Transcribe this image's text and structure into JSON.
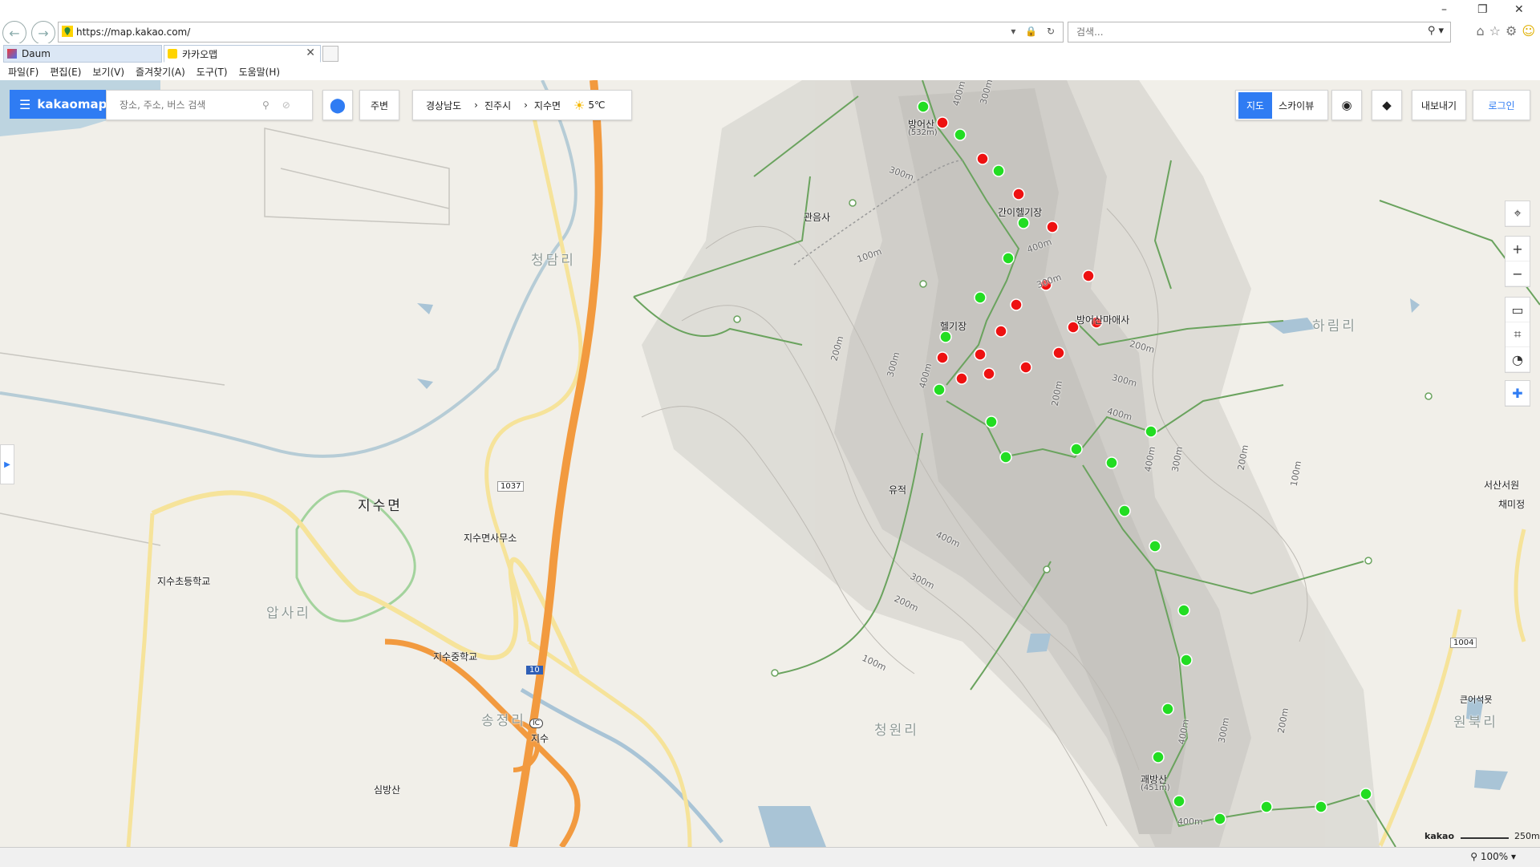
{
  "browser": {
    "url": "https://map.kakao.com/",
    "search_placeholder": "검색...",
    "tabs": [
      {
        "label": "Daum"
      },
      {
        "label": "카카오맵"
      }
    ],
    "menu": [
      "파일(F)",
      "편집(E)",
      "보기(V)",
      "즐겨찾기(A)",
      "도구(T)",
      "도움말(H)"
    ],
    "window_controls": [
      "–",
      "❐",
      "✕"
    ],
    "zoom": "100%"
  },
  "map_ui": {
    "logo_text": "kakaomap",
    "search_placeholder": "장소, 주소, 버스 검색",
    "near_label": "주변",
    "breadcrumb": [
      "경상남도",
      "진주시",
      "지수면"
    ],
    "weather": "5℃",
    "mode_map": "지도",
    "mode_sky": "스카이뷰",
    "export_label": "내보내기",
    "login_label": "로그인",
    "scale_brand": "kakao",
    "scale_text": "250m"
  },
  "labels": {
    "big": [
      "청담리",
      "하림리",
      "압사리",
      "청원리",
      "원북리",
      "송정리"
    ],
    "region": "지수면",
    "places": [
      "방어산",
      "(532m)",
      "관음사",
      "간이헬기장",
      "헬기장",
      "방어산마애사",
      "유적",
      "지수면사무소",
      "지수초등학교",
      "지수중학교",
      "지수",
      "심방산",
      "괘방산",
      "(451m)",
      "서산서원",
      "채미정",
      "큰어석묫"
    ],
    "roads": [
      "1037",
      "10",
      "1004",
      "IC"
    ],
    "contours": [
      "400m",
      "300m",
      "300m",
      "400m",
      "300m",
      "200m",
      "300m",
      "400m",
      "200m",
      "300m",
      "400m",
      "400m",
      "300m",
      "200m",
      "100m",
      "200m",
      "400m",
      "300m",
      "200m",
      "100m",
      "400m",
      "300m",
      "200m",
      "400m",
      "100m"
    ]
  },
  "colors": {
    "accent": "#2f7cf3",
    "green_marker": "#22dd22",
    "red_marker": "#ee1111",
    "highway": "#f29a3f",
    "road": "#f6e39a",
    "water": "#a9c4d6"
  },
  "icons": {
    "back": "arrow-left-icon",
    "forward": "arrow-right-icon",
    "search": "search-icon",
    "location": "location-pin-icon",
    "layers": "layers-icon",
    "locate": "crosshair-icon",
    "zoom_in": "plus-icon",
    "zoom_out": "minus-icon",
    "ruler": "ruler-icon",
    "area": "area-icon",
    "compass": "compass-icon",
    "roadview": "roadview-icon"
  }
}
